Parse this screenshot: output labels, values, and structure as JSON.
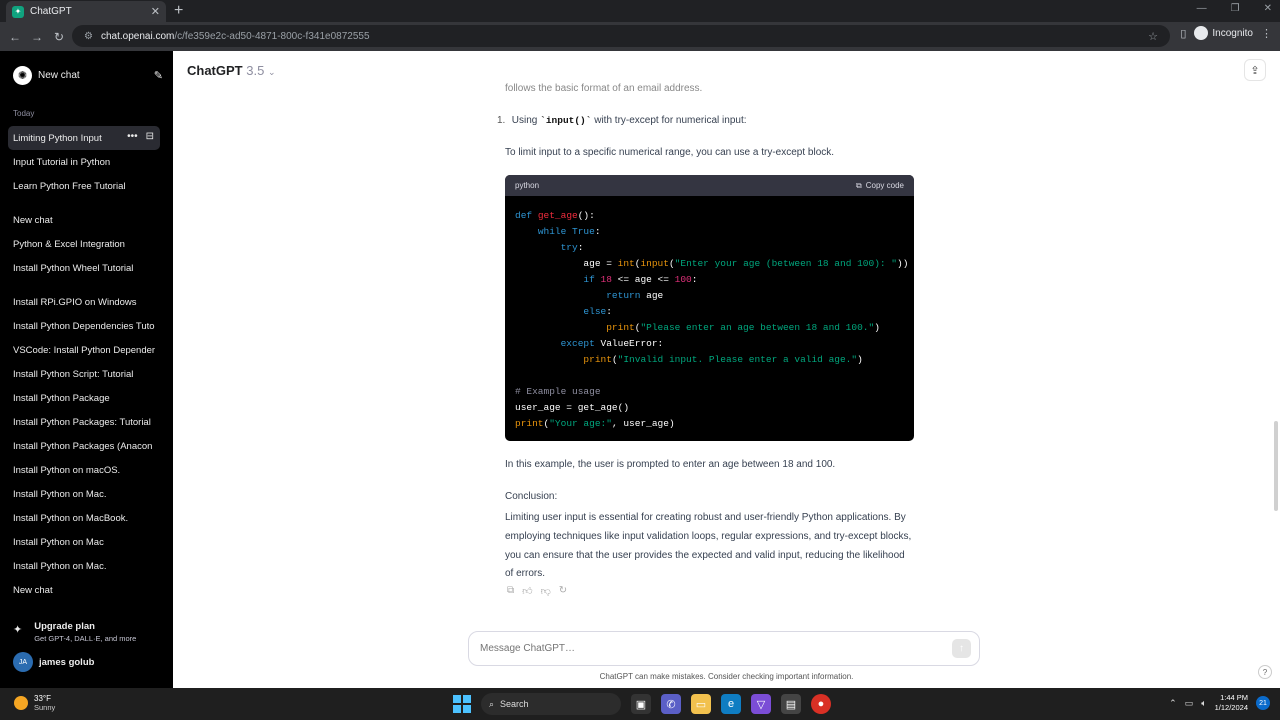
{
  "browser": {
    "tab_title": "ChatGPT",
    "url_host": "chat.openai.com",
    "url_path": "/c/fe359e2c-ad50-4871-800c-f341e0872555",
    "incognito_label": "Incognito"
  },
  "sidebar": {
    "new_chat_label": "New chat",
    "section_today": "Today",
    "items": [
      {
        "label": "Limiting Python Input"
      },
      {
        "label": "Input Tutorial in Python"
      },
      {
        "label": "Learn Python Free Tutorial"
      },
      {
        "label": "New chat"
      },
      {
        "label": "Python & Excel Integration"
      },
      {
        "label": "Install Python Wheel Tutorial"
      },
      {
        "label": "Install RPi.GPIO on Windows"
      },
      {
        "label": "Install Python Dependencies Tuto"
      },
      {
        "label": "VSCode: Install Python Depender"
      },
      {
        "label": "Install Python Script: Tutorial"
      },
      {
        "label": "Install Python Package"
      },
      {
        "label": "Install Python Packages: Tutorial"
      },
      {
        "label": "Install Python Packages (Anacon"
      },
      {
        "label": "Install Python on macOS."
      },
      {
        "label": "Install Python on Mac."
      },
      {
        "label": "Install Python on MacBook."
      },
      {
        "label": "Install Python on Mac"
      },
      {
        "label": "Install Python on Mac."
      },
      {
        "label": "New chat"
      }
    ],
    "upgrade_title": "Upgrade plan",
    "upgrade_sub": "Get GPT-4, DALL·E, and more",
    "user_initials": "JA",
    "user_name": "james golub"
  },
  "header": {
    "model_name": "ChatGPT",
    "model_version": "3.5"
  },
  "message": {
    "cut_line": "follows the basic format of an email address.",
    "step_number": "1.",
    "step_prefix": "Using ",
    "step_code": "`input()`",
    "step_suffix": " with try-except for numerical input:",
    "para1": "To limit input to a specific numerical range, you can use a try-except block.",
    "code_lang": "python",
    "copy_label": "Copy code",
    "para2": "In this example, the user is prompted to enter an age between 18 and 100.",
    "conclusion_label": "Conclusion:",
    "conclusion_body": "Limiting user input is essential for creating robust and user-friendly Python applications. By employing techniques like input validation loops, regular expressions, and try-except blocks, you can ensure that the user provides the expected and valid input, reducing the likelihood of errors."
  },
  "code": {
    "l1_def": "def ",
    "l1_fn": "get_age",
    "l1_rest": "():",
    "l2_kw": "while ",
    "l2_true": "True",
    "l2_rest": ":",
    "l3_kw": "try",
    "l3_rest": ":",
    "l4_a": "age = ",
    "l4_int": "int",
    "l4_p": "(",
    "l4_input": "input",
    "l4_p2": "(",
    "l4_str": "\"Enter your age (between 18 and 100): \"",
    "l4_end": "))",
    "l5_if": "if ",
    "l5_n1": "18",
    "l5_mid": " <= age <= ",
    "l5_n2": "100",
    "l5_end": ":",
    "l6_kw": "return ",
    "l6_rest": "age",
    "l7_kw": "else",
    "l7_rest": ":",
    "l8_fn": "print",
    "l8_p": "(",
    "l8_str": "\"Please enter an age between 18 and 100.\"",
    "l8_end": ")",
    "l9_kw": "except ",
    "l9_rest": "ValueError:",
    "l10_fn": "print",
    "l10_p": "(",
    "l10_str": "\"Invalid input. Please enter a valid age.\"",
    "l10_end": ")",
    "l12_cm": "# Example usage",
    "l13": "user_age = get_age()",
    "l14_fn": "print",
    "l14_p": "(",
    "l14_str": "\"Your age:\"",
    "l14_end": ", user_age)"
  },
  "composer": {
    "placeholder": "Message ChatGPT…",
    "disclaimer": "ChatGPT can make mistakes. Consider checking important information.",
    "help": "?"
  },
  "taskbar": {
    "temp": "33°F",
    "condition": "Sunny",
    "search_label": "Search",
    "time": "1:44 PM",
    "date": "1/12/2024",
    "notif_count": "21"
  },
  "colors": {
    "sidebar_bg": "#000000",
    "code_bg": "#000000",
    "accent": "#10a37f"
  }
}
